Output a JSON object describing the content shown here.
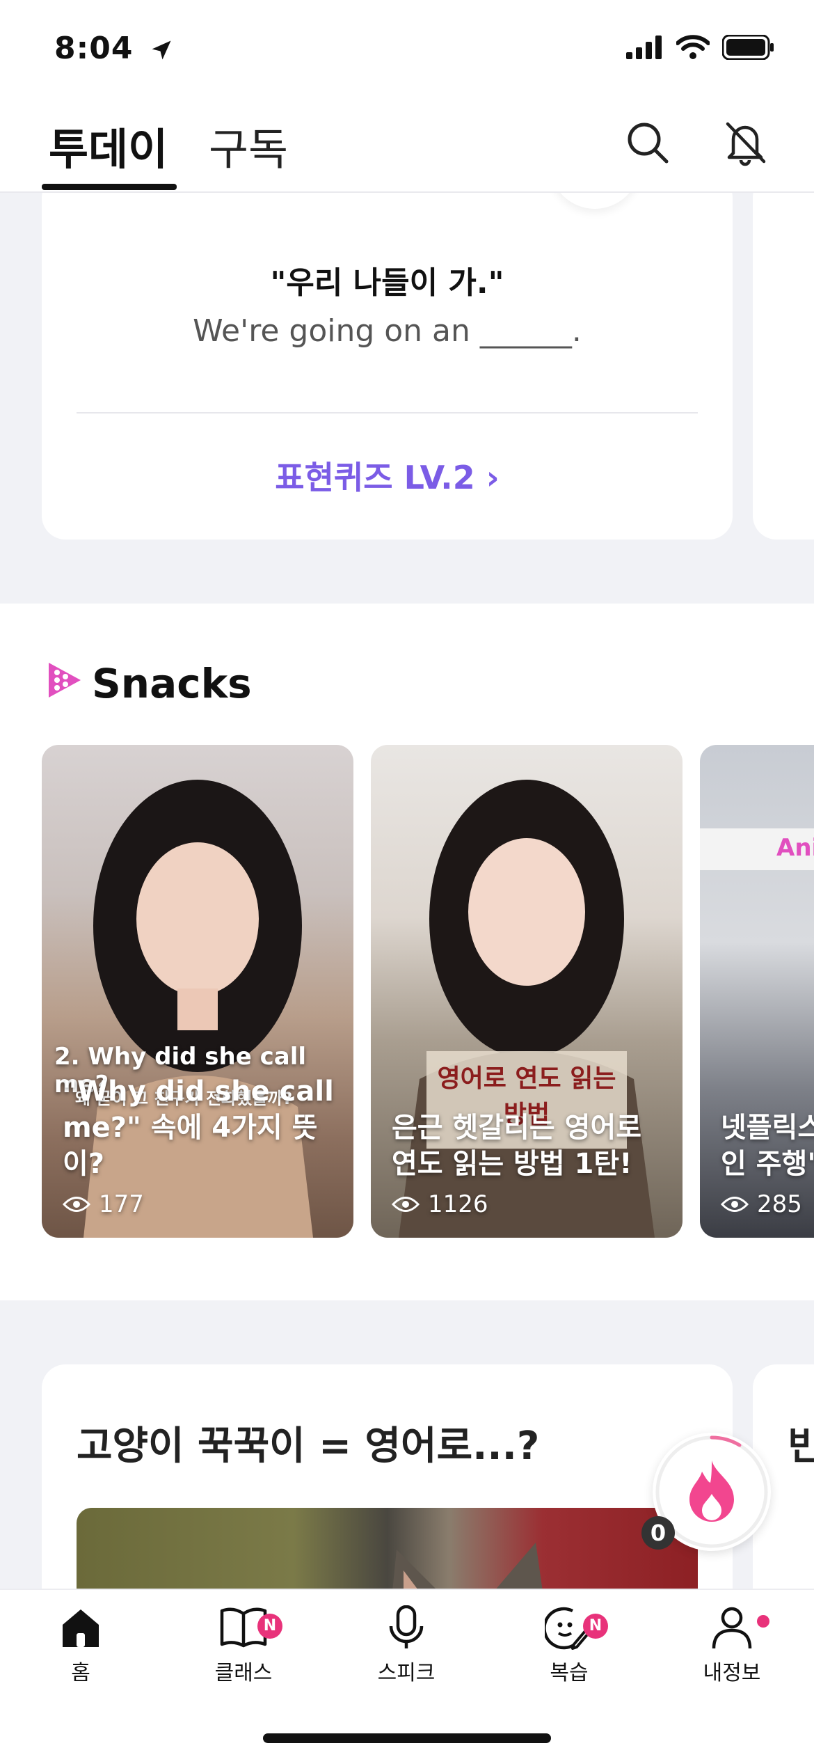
{
  "status": {
    "time": "8:04"
  },
  "header": {
    "tab_today": "투데이",
    "tab_subscribe": "구독"
  },
  "quiz": {
    "korean": "\"우리 나들이 가.\"",
    "english": "We're going on an ______.",
    "link": "표현퀴즈 LV.2 ›"
  },
  "snacks": {
    "title": "Snacks",
    "items": [
      {
        "overlay_en": "2. Why did she call me?",
        "overlay_ko": "왜 굳이 그 친구가 전화했을까?",
        "title": "\"Why did she call me?\" 속에 4가지 뜻이?",
        "views": "177"
      },
      {
        "overlay_ko": "영어로 연도 읽는 방법",
        "title": "은근 헷갈리는 영어로 연도 읽는 방법 1탄!",
        "views": "1126"
      },
      {
        "overlay_en": "Ani",
        "title": "넷플릭스 케이크 인 주행'은",
        "views": "285"
      }
    ]
  },
  "article": {
    "title": "고양이 꾹꾹이 = 영어로...?",
    "peek_title": "빈"
  },
  "streak": {
    "count": "0"
  },
  "bottom_nav": {
    "items": [
      {
        "label": "홈",
        "badge": ""
      },
      {
        "label": "클래스",
        "badge": "N"
      },
      {
        "label": "스피크",
        "badge": ""
      },
      {
        "label": "복습",
        "badge": "N"
      },
      {
        "label": "내정보",
        "badge": ""
      }
    ]
  },
  "colors": {
    "accent": "#7b5ce6",
    "badge": "#e8327a",
    "feed_bg": "#f1f2f6"
  }
}
